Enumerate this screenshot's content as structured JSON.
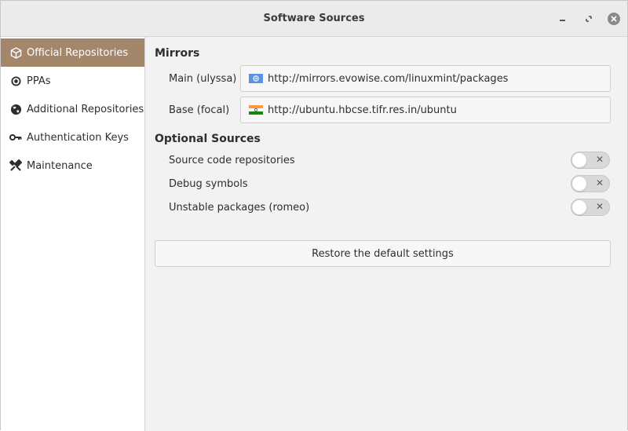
{
  "window": {
    "title": "Software Sources"
  },
  "sidebar": {
    "items": [
      {
        "label": "Official Repositories",
        "icon": "box-icon",
        "active": true
      },
      {
        "label": "PPAs",
        "icon": "ppa-icon",
        "active": false
      },
      {
        "label": "Additional Repositories",
        "icon": "globe-icon",
        "active": false
      },
      {
        "label": "Authentication Keys",
        "icon": "key-icon",
        "active": false
      },
      {
        "label": "Maintenance",
        "icon": "tools-icon",
        "active": false
      }
    ]
  },
  "mirrors": {
    "heading": "Mirrors",
    "main": {
      "label": "Main (ulyssa)",
      "url": "http://mirrors.evowise.com/linuxmint/packages",
      "flag": "un-flag-icon"
    },
    "base": {
      "label": "Base (focal)",
      "url": "http://ubuntu.hbcse.tifr.res.in/ubuntu",
      "flag": "india-flag-icon"
    }
  },
  "optional": {
    "heading": "Optional Sources",
    "items": [
      {
        "label": "Source code repositories",
        "enabled": false
      },
      {
        "label": "Debug symbols",
        "enabled": false
      },
      {
        "label": "Unstable packages (romeo)",
        "enabled": false
      }
    ]
  },
  "restore_label": "Restore the default settings",
  "colors": {
    "accent": "#a4866a",
    "close_button": "#8a8a8a"
  }
}
